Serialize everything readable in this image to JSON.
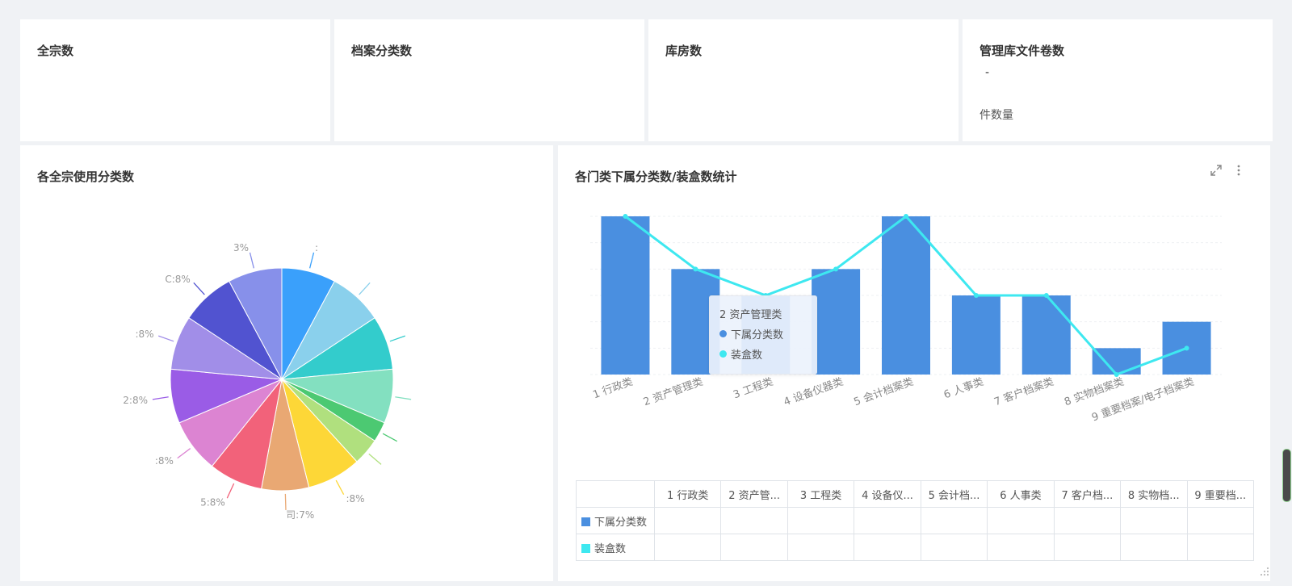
{
  "kpis": [
    {
      "title": "全宗数",
      "value": "",
      "sub": ""
    },
    {
      "title": "档案分类数",
      "value": "",
      "sub": ""
    },
    {
      "title": "库房数",
      "value": "",
      "sub": ""
    },
    {
      "title": "管理库文件卷数",
      "value": "-",
      "sub": "件数量"
    }
  ],
  "pie_panel": {
    "title": "各全宗使用分类数"
  },
  "bar_panel": {
    "title": "各门类下属分类数/装盒数统计",
    "tooltip": {
      "title": "2 资产管理类",
      "rows": [
        {
          "label": "下属分类数",
          "color": "#4a8fe0"
        },
        {
          "label": "装盒数",
          "color": "#3ee8f0"
        }
      ]
    },
    "table": {
      "headers": [
        "1 行政类",
        "2 资产管...",
        "3 工程类",
        "4 设备仪...",
        "5 会计档...",
        "6 人事类",
        "7 客户档...",
        "8 实物档...",
        "9 重要档..."
      ],
      "rows": [
        {
          "label": "下属分类数",
          "color": "#4a8fe0",
          "cells": [
            "",
            "",
            "",
            "",
            "",
            "",
            "",
            "",
            ""
          ]
        },
        {
          "label": "装盒数",
          "color": "#3ee8f0",
          "cells": [
            "",
            "",
            "",
            "",
            "",
            "",
            "",
            "",
            ""
          ]
        }
      ]
    }
  },
  "chart_data": [
    {
      "type": "pie",
      "title": "各全宗使用分类数",
      "slices": [
        {
          "label": ":",
          "value": 8,
          "color": "#3aa0fb"
        },
        {
          "label": "",
          "value": 8,
          "color": "#8ad0ec"
        },
        {
          "label": "",
          "value": 8,
          "color": "#33cccc"
        },
        {
          "label": "",
          "value": 8,
          "color": "#83e0c0"
        },
        {
          "label": "",
          "value": 3,
          "color": "#4cc972"
        },
        {
          "label": "",
          "value": 4,
          "color": "#b0e07e"
        },
        {
          "label": ":8%",
          "value": 8,
          "color": "#fdd737"
        },
        {
          "label": "司:7%",
          "value": 7,
          "color": "#e9a873"
        },
        {
          "label": "5:8%",
          "value": 8,
          "color": "#f2627a"
        },
        {
          "label": ":8%",
          "value": 8,
          "color": "#dc84d2"
        },
        {
          "label": "2:8%",
          "value": 8,
          "color": "#9a5ce6"
        },
        {
          "label": ":8%",
          "value": 8,
          "color": "#a18ee8"
        },
        {
          "label": "C:8%",
          "value": 8,
          "color": "#5153d0"
        },
        {
          "label": "3%",
          "value": 8,
          "color": "#8790ea"
        }
      ]
    },
    {
      "type": "bar",
      "title": "各门类下属分类数/装盒数统计",
      "categories": [
        "1 行政类",
        "2 资产管理类",
        "3 工程类",
        "4 设备仪器类",
        "5 会计档案类",
        "6 人事类",
        "7 客户档案类",
        "8 实物档案类",
        "9 重要档案/电子档案类"
      ],
      "ylim": [
        0,
        6
      ],
      "series": [
        {
          "name": "下属分类数",
          "kind": "bar",
          "color": "#4a8fe0",
          "values": [
            6,
            4,
            3,
            4,
            6,
            3,
            3,
            1,
            2
          ]
        },
        {
          "name": "装盒数",
          "kind": "line",
          "color": "#3ee8f0",
          "values": [
            6,
            4,
            3,
            4,
            6,
            3,
            3,
            0,
            1
          ]
        }
      ],
      "grid": true,
      "legend": "none"
    }
  ]
}
